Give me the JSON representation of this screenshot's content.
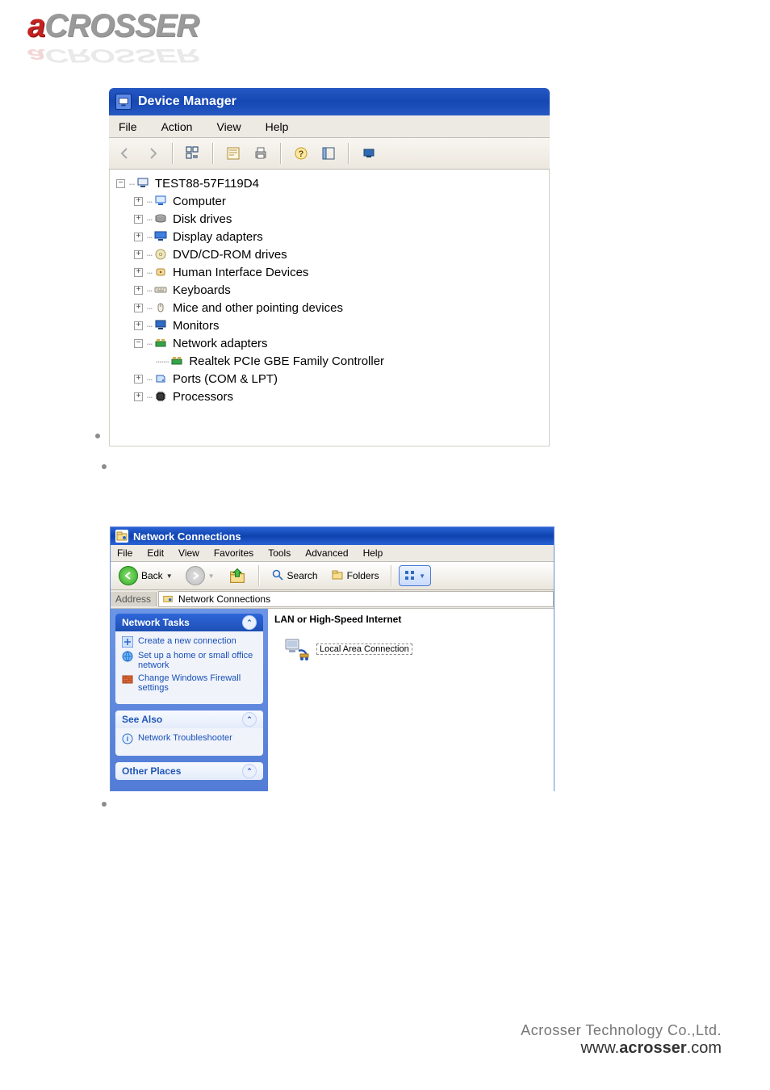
{
  "brand": {
    "first": "a",
    "rest": "CROSSER"
  },
  "device_manager": {
    "title": "Device Manager",
    "menu": {
      "file": "File",
      "action": "Action",
      "view": "View",
      "help": "Help"
    },
    "toolbar": {
      "back": "back",
      "forward": "forward",
      "list": "show tree",
      "properties": "properties",
      "print": "print",
      "help": "help",
      "show_hidden": "show hidden",
      "extra": "scan"
    },
    "tree": {
      "root": "TEST88-57F119D4",
      "items": [
        {
          "exp": "+",
          "icon": "computer-icon",
          "label": "Computer"
        },
        {
          "exp": "+",
          "icon": "disk-icon",
          "label": "Disk drives"
        },
        {
          "exp": "+",
          "icon": "display-icon",
          "label": "Display adapters"
        },
        {
          "exp": "+",
          "icon": "dvd-icon",
          "label": "DVD/CD-ROM drives"
        },
        {
          "exp": "+",
          "icon": "hid-icon",
          "label": "Human Interface Devices"
        },
        {
          "exp": "+",
          "icon": "keyboard-icon",
          "label": "Keyboards"
        },
        {
          "exp": "+",
          "icon": "mouse-icon",
          "label": "Mice and other pointing devices"
        },
        {
          "exp": "+",
          "icon": "monitor-icon",
          "label": "Monitors"
        },
        {
          "exp": "-",
          "icon": "nic-icon",
          "label": "Network adapters",
          "children": [
            {
              "icon": "nic-icon",
              "label": "Realtek PCIe GBE Family Controller"
            }
          ]
        },
        {
          "exp": "+",
          "icon": "ports-icon",
          "label": "Ports (COM & LPT)"
        },
        {
          "exp": "+",
          "icon": "cpu-icon",
          "label": "Processors"
        }
      ]
    }
  },
  "network_connections": {
    "title": "Network Connections",
    "menu": {
      "file": "File",
      "edit": "Edit",
      "view": "View",
      "favorites": "Favorites",
      "tools": "Tools",
      "advanced": "Advanced",
      "help": "Help"
    },
    "toolbar": {
      "back": "Back",
      "forward": "Forward",
      "up": "Up",
      "search": "Search",
      "folders": "Folders",
      "views": "Views"
    },
    "address": {
      "label": "Address",
      "path": "Network Connections"
    },
    "side": {
      "tasks": {
        "title": "Network Tasks",
        "items": [
          {
            "icon": "new-conn-icon",
            "label": "Create a new connection"
          },
          {
            "icon": "home-net-icon",
            "label": "Set up a home or small office network"
          },
          {
            "icon": "firewall-icon",
            "label": "Change Windows Firewall settings"
          }
        ]
      },
      "see_also": {
        "title": "See Also",
        "items": [
          {
            "icon": "info-icon",
            "label": "Network Troubleshooter"
          }
        ]
      },
      "other": {
        "title": "Other Places"
      }
    },
    "main": {
      "category": "LAN or High-Speed Internet",
      "item": "Local Area Connection"
    }
  },
  "footer": {
    "line1": "Acrosser Technology Co.,Ltd.",
    "line2_a": "www.",
    "line2_b": "acrosser",
    "line2_c": ".com"
  }
}
